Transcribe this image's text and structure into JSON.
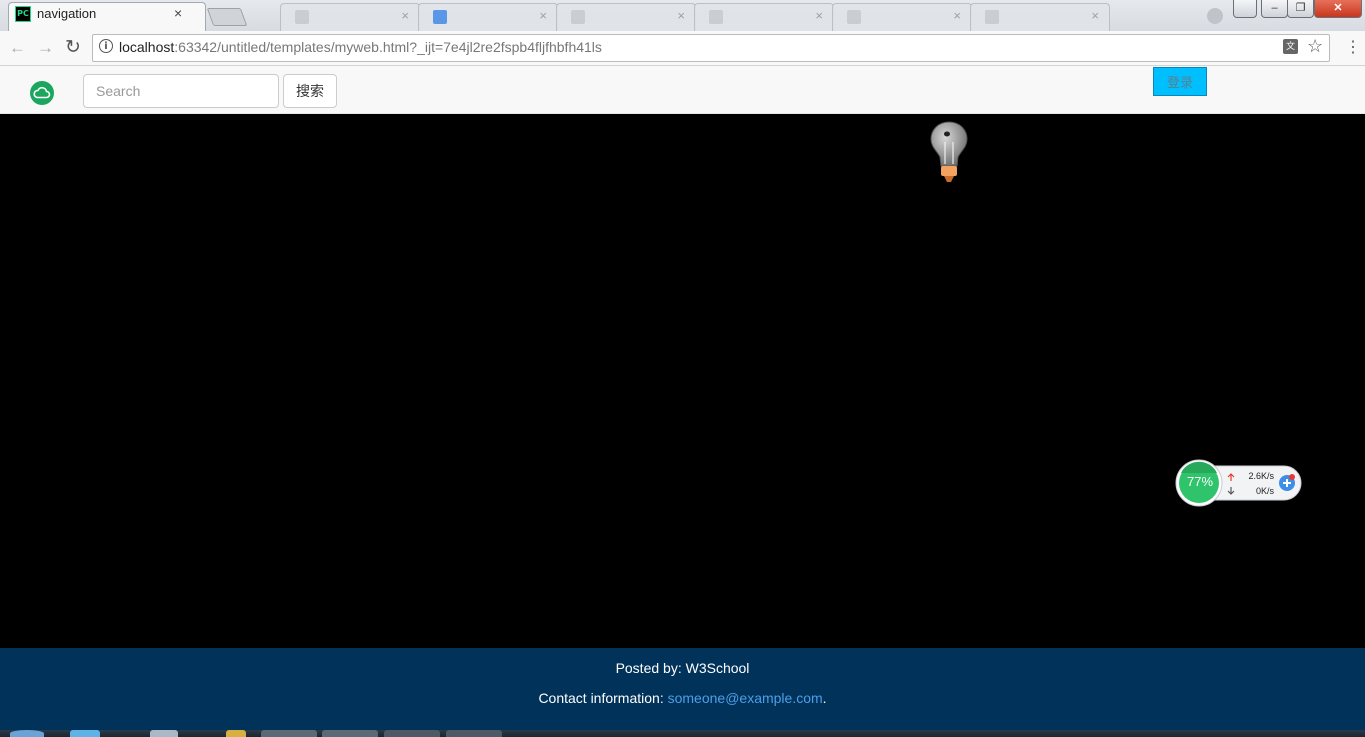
{
  "browser": {
    "active_tab": {
      "icon_text": "PC",
      "title": "navigation",
      "close": "×"
    },
    "background_tabs": [
      {
        "title": "",
        "close": "×"
      },
      {
        "title": "",
        "close": "×"
      },
      {
        "title": "",
        "close": "×"
      },
      {
        "title": "",
        "close": "×"
      },
      {
        "title": "",
        "close": "×"
      },
      {
        "title": "",
        "close": "×"
      }
    ],
    "url_host": "localhost",
    "url_rest": ":63342/untitled/templates/myweb.html?_ijt=7e4jl2re2fspb4fljfhbfh41ls",
    "info_glyph": "i",
    "translate_glyph": "文",
    "star_glyph": "☆",
    "menu_glyph": "⋮",
    "back_glyph": "←",
    "forward_glyph": "→",
    "reload_glyph": "↻",
    "window_buttons": {
      "minimize": "–",
      "restore": "❐",
      "close": "✕"
    }
  },
  "navbar": {
    "search_placeholder": "Search",
    "search_button": "搜索",
    "login_button": "登录"
  },
  "widget": {
    "percent": "77%",
    "upload": "2.6K/s",
    "download": "0K/s"
  },
  "footer": {
    "posted_by": "Posted by: W3School",
    "contact_label": "Contact information: ",
    "contact_email": "someone@example.com",
    "contact_end": "."
  },
  "colors": {
    "footer_bg": "#00325a",
    "login_bg": "#00bfff",
    "logo": "#1aa65d",
    "widget_green": "#2fc36b"
  }
}
